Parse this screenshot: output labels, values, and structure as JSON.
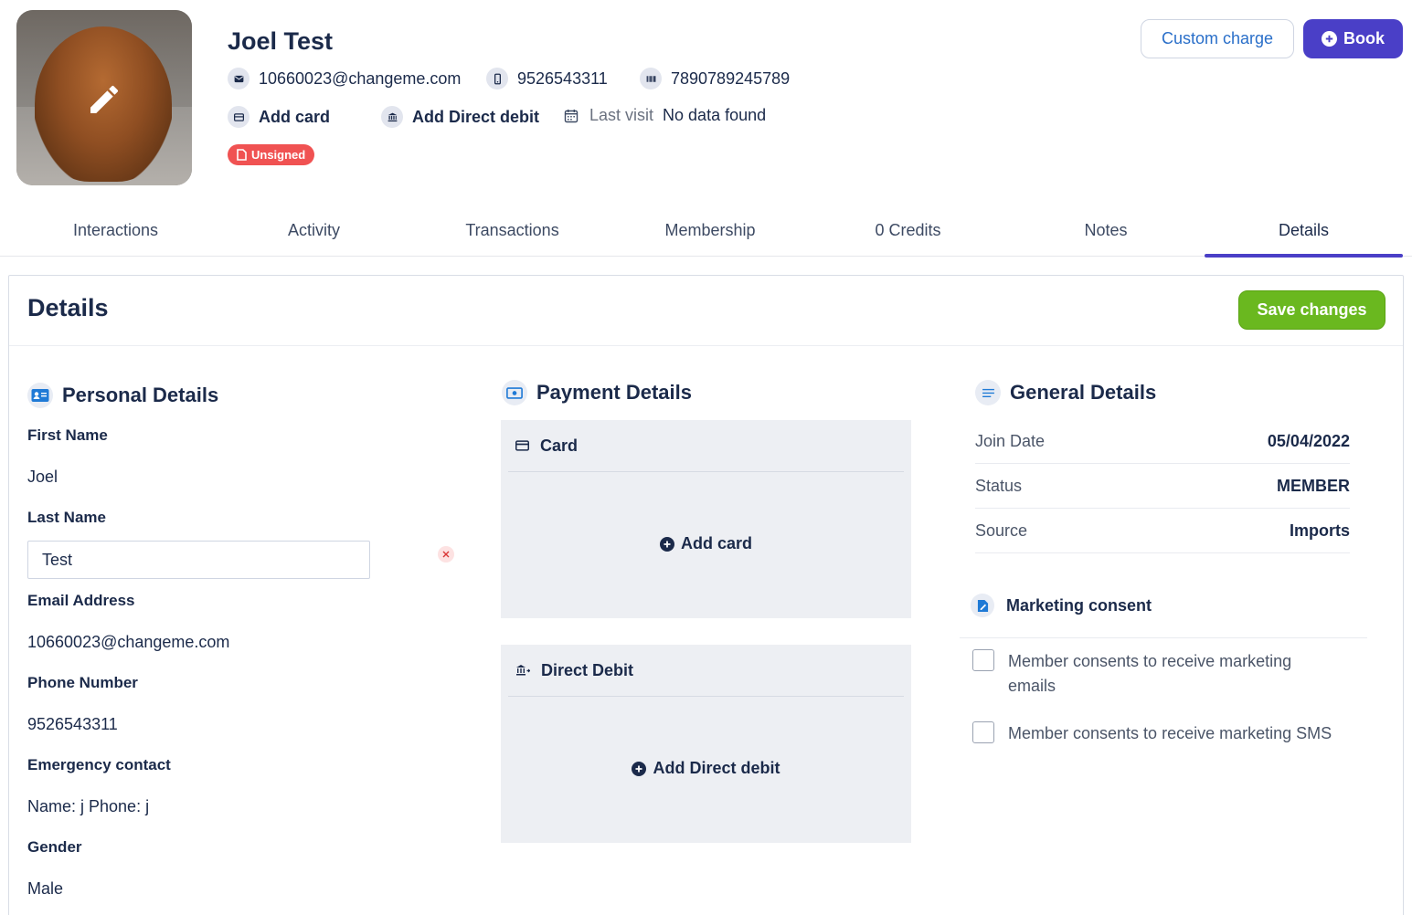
{
  "member": {
    "name": "Joel Test",
    "email": "10660023@changeme.com",
    "phone": "9526543311",
    "barcode": "7890789245789",
    "add_card_label": "Add card",
    "add_direct_debit_label": "Add Direct debit",
    "last_visit_label": "Last visit",
    "last_visit_value": "No data found",
    "badge": "Unsigned"
  },
  "actions": {
    "custom_charge": "Custom charge",
    "book": "Book"
  },
  "tabs": [
    {
      "label": "Interactions"
    },
    {
      "label": "Activity"
    },
    {
      "label": "Transactions"
    },
    {
      "label": "Membership"
    },
    {
      "label": "0 Credits"
    },
    {
      "label": "Notes"
    },
    {
      "label": "Details",
      "active": true
    }
  ],
  "details": {
    "title": "Details",
    "save_label": "Save changes",
    "personal": {
      "title": "Personal Details",
      "first_name_label": "First Name",
      "first_name": "Joel",
      "last_name_label": "Last Name",
      "last_name": "Test",
      "email_label": "Email Address",
      "email": "10660023@changeme.com",
      "phone_label": "Phone Number",
      "phone": "9526543311",
      "emergency_label": "Emergency contact",
      "emergency": "Name: j Phone: j",
      "gender_label": "Gender",
      "gender": "Male"
    },
    "payment": {
      "title": "Payment Details",
      "card_title": "Card",
      "add_card": "Add card",
      "dd_title": "Direct Debit",
      "add_dd": "Add Direct debit"
    },
    "general": {
      "title": "General Details",
      "rows": [
        {
          "key": "Join Date",
          "value": "05/04/2022"
        },
        {
          "key": "Status",
          "value": "MEMBER"
        },
        {
          "key": "Source",
          "value": "Imports"
        }
      ],
      "marketing_title": "Marketing consent",
      "consent_email": "Member consents to receive marketing emails",
      "consent_sms": "Member consents to receive marketing SMS"
    }
  },
  "colors": {
    "primary": "#4a3fc7",
    "save": "#6ab81f",
    "badge": "#f05252",
    "text": "#1b2a4a",
    "link": "#2a6fc9"
  }
}
